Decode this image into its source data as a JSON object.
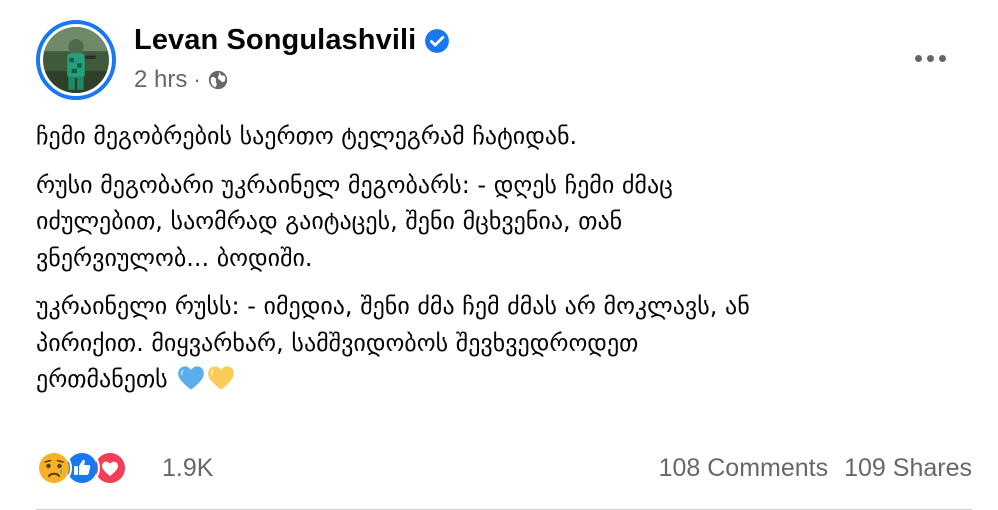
{
  "post": {
    "author": "Levan Songulashvili",
    "time": "2 hrs",
    "separator": "·",
    "paragraphs": [
      "ჩემი მეგობრების საერთო ტელეგრამ ჩატიდან.",
      "რუსი მეგობარი უკრაინელ მეგობარს: - დღეს ჩემი ძმაც\nიძულებით, საომრად გაიტაცეს, შენი მცხვენია, თან\nვნერვიულობ... ბოდიში.",
      "უკრაინელი რუსს: - იმედია, შენი ძმა ჩემ ძმას არ მოკლავს, ან\nპირიქით. მიყვარხარ, სამშვიდობოს შევხვედროდეთ\nერთმანეთს"
    ],
    "icons": {
      "verified": "verified-badge-icon",
      "audience": "globe-icon",
      "more": "more-options-icon",
      "heart_blue": "blue-heart-emoji",
      "heart_yellow": "yellow-heart-emoji"
    }
  },
  "footer": {
    "reactions": [
      "sad-reaction",
      "like-reaction",
      "love-reaction"
    ],
    "reaction_count": "1.9K",
    "comments": "108 Comments",
    "shares": "109 Shares"
  },
  "colors": {
    "accent": "#1877f2",
    "secondary_text": "#65676b",
    "love": "#f33e58",
    "sad": "#f7b125",
    "blue_heart": "#5cadec",
    "yellow_heart": "#fdcb58"
  }
}
